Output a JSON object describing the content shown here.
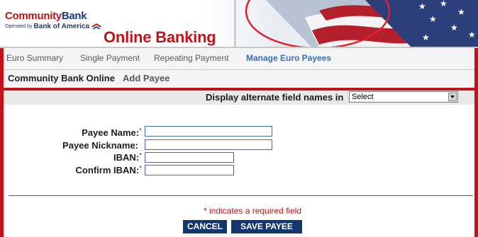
{
  "brand": {
    "name_part1": "Community",
    "name_part2": "Bank",
    "operated_by": "Operated by",
    "parent": "Bank of America",
    "section_title": "Online Banking"
  },
  "nav": {
    "items": [
      {
        "label": "Euro Summary"
      },
      {
        "label": "Single Payment"
      },
      {
        "label": "Repeating Payment"
      },
      {
        "label": "Manage Euro Payees"
      }
    ]
  },
  "breadcrumb": {
    "root": "Community Bank Online",
    "current": "Add Payee"
  },
  "alt_names": {
    "label": "Display alternate field names in",
    "selected": "Select"
  },
  "form": {
    "payee_name_label": "Payee Name:",
    "payee_nickname_label": "Payee Nickname:",
    "iban_label": "IBAN:",
    "confirm_iban_label": "Confirm IBAN:",
    "required_mark": "*"
  },
  "footer": {
    "required_note": "* indicates a required field",
    "cancel_label": "CANCEL",
    "save_label": "SAVE PAYEE"
  },
  "colors": {
    "brand_red": "#c0121b",
    "brand_navy": "#14366f",
    "link_blue": "#3b6fb5"
  }
}
